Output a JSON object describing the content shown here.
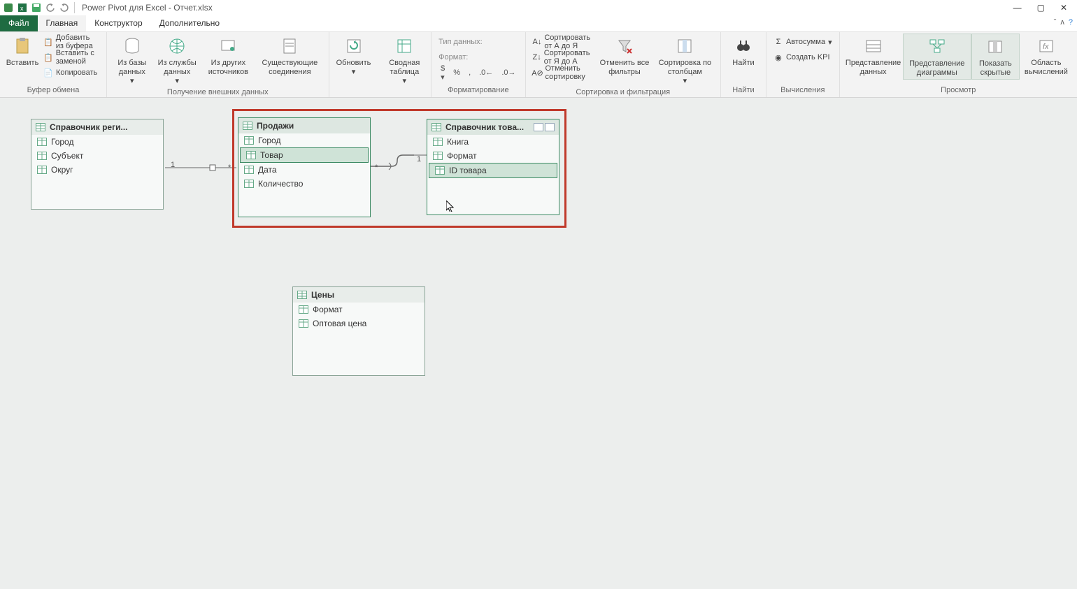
{
  "titlebar": {
    "title": "Power Pivot для Excel - Отчет.xlsx"
  },
  "tabs": {
    "file": "Файл",
    "home": "Главная",
    "design": "Конструктор",
    "advanced": "Дополнительно"
  },
  "ribbon": {
    "clipboard": {
      "paste": "Вставить",
      "add_from_buffer": "Добавить из буфера",
      "paste_replace": "Вставить с заменой",
      "copy": "Копировать",
      "label": "Буфер обмена"
    },
    "external": {
      "from_db": "Из базы данных",
      "from_service": "Из службы данных",
      "from_other": "Из других источников",
      "existing": "Существующие соединения",
      "label": "Получение внешних данных"
    },
    "refresh": {
      "refresh": "Обновить"
    },
    "pivot": {
      "pivot": "Сводная таблица"
    },
    "format": {
      "datatype": "Тип данных:",
      "format": "Формат:",
      "label": "Форматирование"
    },
    "sort": {
      "az": "Сортировать от А до Я",
      "za": "Сортировать от Я до А",
      "clear": "Отменить сортировку",
      "clear_filters": "Отменить все фильтры",
      "by_column": "Сортировка по столбцам",
      "label": "Сортировка и фильтрация"
    },
    "find": {
      "find": "Найти",
      "label": "Найти"
    },
    "calc": {
      "autosum": "Автосумма",
      "kpi": "Создать KPI",
      "label": "Вычисления"
    },
    "view": {
      "data": "Представление данных",
      "diagram": "Представление диаграммы",
      "hidden": "Показать скрытые",
      "calc_area": "Область вычислений",
      "label": "Просмотр"
    }
  },
  "tables": {
    "regions": {
      "title": "Справочник реги...",
      "fields": [
        "Город",
        "Субъект",
        "Округ"
      ]
    },
    "sales": {
      "title": "Продажи",
      "fields": [
        "Город",
        "Товар",
        "Дата",
        "Количество"
      ]
    },
    "products": {
      "title": "Справочник това...",
      "fields": [
        "Книга",
        "Формат",
        "ID товара"
      ]
    },
    "prices": {
      "title": "Цены",
      "fields": [
        "Формат",
        "Оптовая цена"
      ]
    }
  },
  "relations": {
    "r1_left": "1",
    "r1_right": "*",
    "r2_left": "*",
    "r2_right": "1"
  }
}
